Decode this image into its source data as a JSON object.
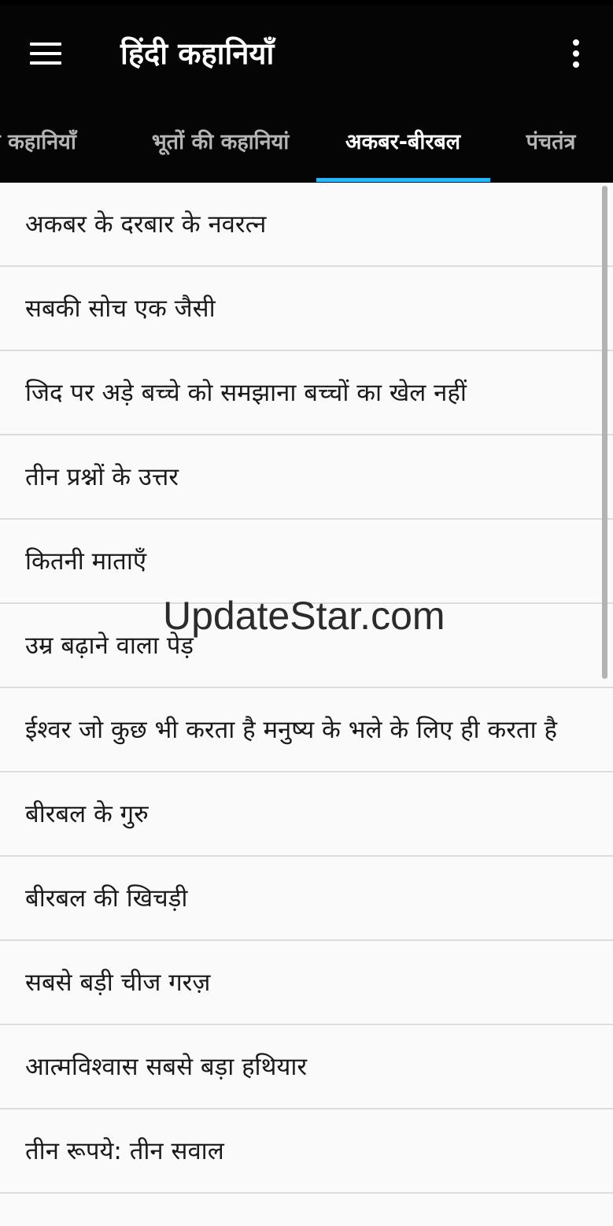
{
  "app": {
    "title": "हिंदी कहानियाँ"
  },
  "icons": {
    "menu": "hamburger-menu-icon",
    "overflow": "more-vert-icon"
  },
  "colors": {
    "appbar": "#050505",
    "tab_indicator": "#29b6f6",
    "background": "#fafafa"
  },
  "tabs": [
    {
      "label": "क कहानियाँ",
      "active": false
    },
    {
      "label": "भूतों की कहानियां",
      "active": false
    },
    {
      "label": "अकबर-बीरबल",
      "active": true
    },
    {
      "label": "पंचतंत्र",
      "active": false
    }
  ],
  "stories": [
    "अकबर के दरबार के नवरत्न",
    "सबकी सोच एक जैसी",
    "जिद पर अड़े बच्चे को समझाना बच्चों का खेल नहीं",
    "तीन प्रश्नों के उत्तर",
    "कितनी माताएँ",
    "उम्र बढ़ाने वाला पेड़",
    "ईश्वर जो कुछ भी करता है मनुष्य के भले के लिए ही करता है",
    "बीरबल के गुरु",
    "बीरबल की खिचड़ी",
    "सबसे बड़ी चीज गरज़",
    "आत्मविश्वास सबसे बड़ा हथियार",
    "तीन रूपये: तीन सवाल"
  ],
  "watermark": "UpdateStar.com"
}
